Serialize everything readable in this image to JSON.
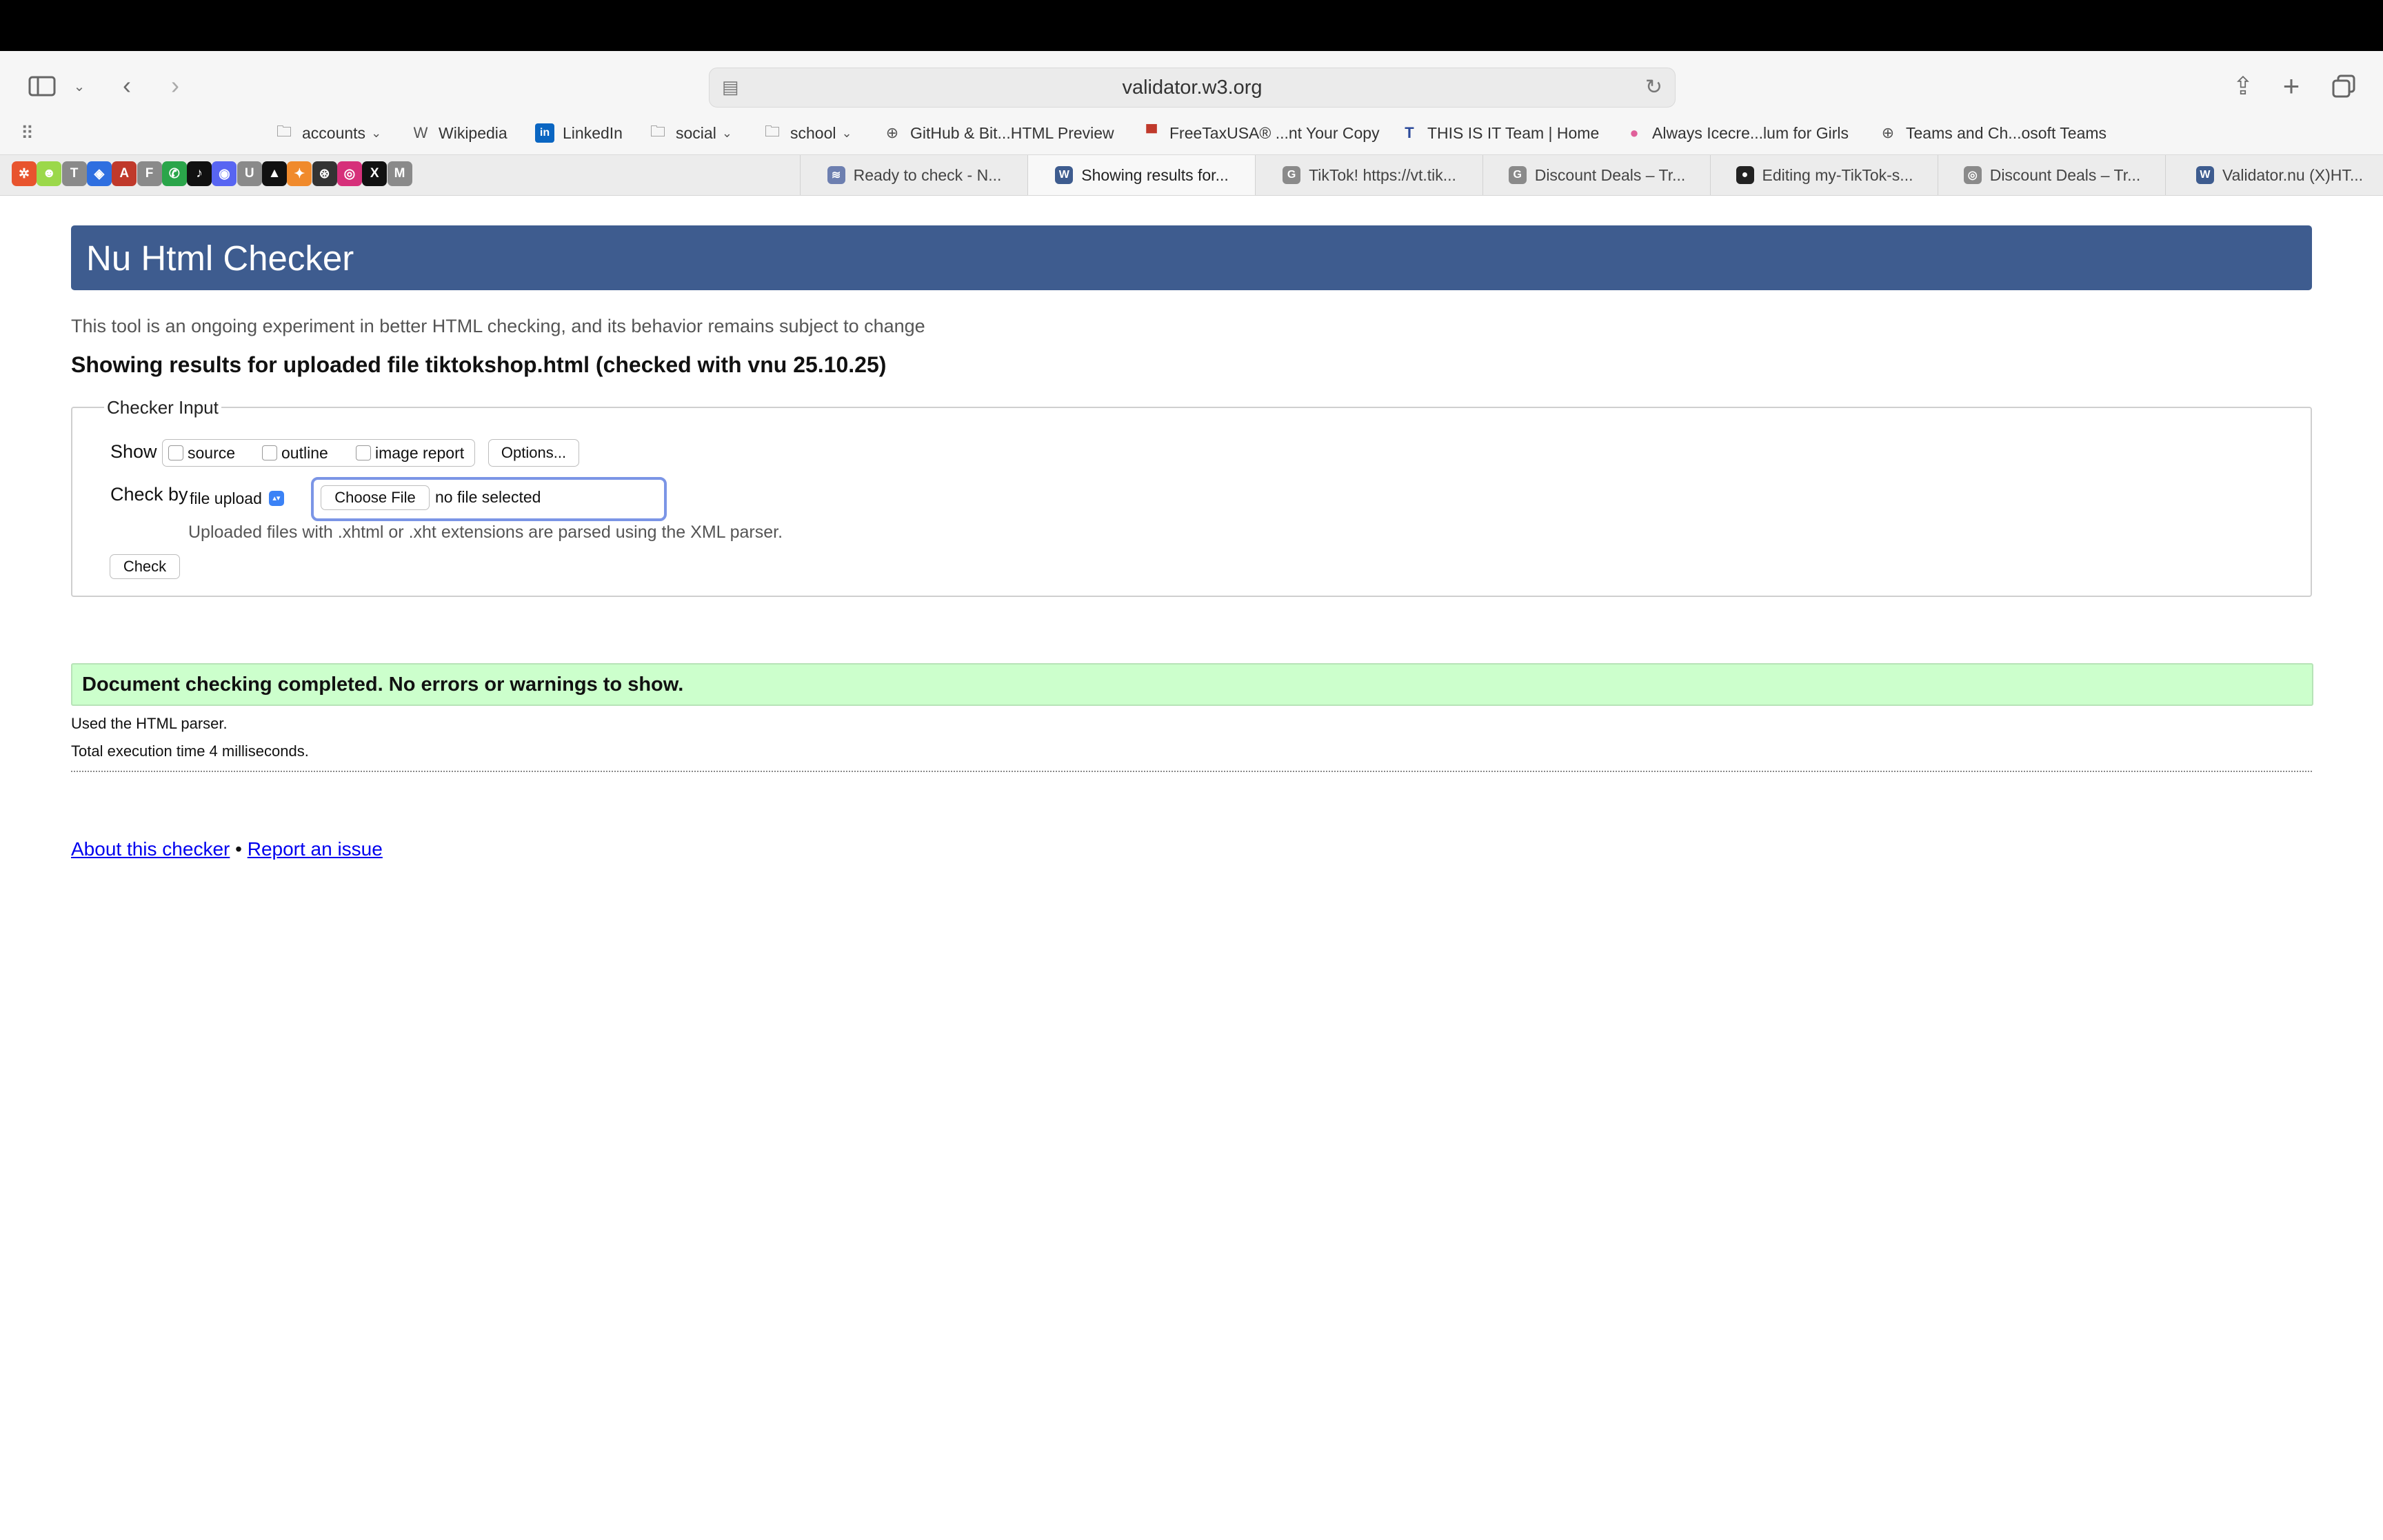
{
  "browser": {
    "url": "validator.w3.org",
    "favorites": [
      {
        "label": "accounts",
        "icon": "folder-icon",
        "chevron": true
      },
      {
        "label": "Wikipedia",
        "icon": "wikipedia-icon",
        "chevron": false
      },
      {
        "label": "LinkedIn",
        "icon": "linkedin-icon",
        "chevron": false
      },
      {
        "label": "social",
        "icon": "folder-icon",
        "chevron": true
      },
      {
        "label": "school",
        "icon": "folder-icon",
        "chevron": true
      },
      {
        "label": "GitHub & Bit...HTML Preview",
        "icon": "globe-icon",
        "chevron": false
      },
      {
        "label": "FreeTaxUSA® ...nt Your Copy",
        "icon": "flag-icon",
        "chevron": false
      },
      {
        "label": "THIS IS IT Team | Home",
        "icon": "team-icon",
        "chevron": false
      },
      {
        "label": "Always Icecre...lum for Girls",
        "icon": "circle-icon",
        "chevron": false
      },
      {
        "label": "Teams and Ch...osoft Teams",
        "icon": "globe-icon",
        "chevron": false
      }
    ],
    "pinned_tabs": [
      {
        "glyph": "✲",
        "color": "#e8542e",
        "icon": "asterisk-app-icon"
      },
      {
        "glyph": "☻",
        "color": "#9bd84a",
        "icon": "smiley-app-icon"
      },
      {
        "glyph": "T",
        "color": "#8a8a8a",
        "icon": "t-letter-icon"
      },
      {
        "glyph": "◈",
        "color": "#2f6fe0",
        "icon": "diamond-app-icon"
      },
      {
        "glyph": "A",
        "color": "#c0392b",
        "icon": "a-letter-icon"
      },
      {
        "glyph": "F",
        "color": "#8a8a8a",
        "icon": "f-letter-icon"
      },
      {
        "glyph": "✆",
        "color": "#2aa54a",
        "icon": "phone-icon"
      },
      {
        "glyph": "♪",
        "color": "#111111",
        "icon": "tiktok-icon"
      },
      {
        "glyph": "◉",
        "color": "#5865f2",
        "icon": "discord-icon"
      },
      {
        "glyph": "U",
        "color": "#8a8a8a",
        "icon": "u-letter-icon"
      },
      {
        "glyph": "▲",
        "color": "#111111",
        "icon": "triangle-app-icon"
      },
      {
        "glyph": "✦",
        "color": "#f08a2c",
        "icon": "bird-app-icon"
      },
      {
        "glyph": "⊛",
        "color": "#333333",
        "icon": "openai-icon"
      },
      {
        "glyph": "◎",
        "color": "#d6307a",
        "icon": "instagram-icon"
      },
      {
        "glyph": "X",
        "color": "#111111",
        "icon": "x-icon"
      },
      {
        "glyph": "M",
        "color": "#8a8a8a",
        "icon": "m-letter-icon"
      }
    ],
    "tabs": [
      {
        "label": "Ready to check - N...",
        "icon": "validator-icon",
        "glyph": "≋",
        "color": "#6d7fb0",
        "active": false
      },
      {
        "label": "Showing results for...",
        "icon": "validator-icon",
        "glyph": "W",
        "color": "#3e5c8f",
        "active": true
      },
      {
        "label": "TikTok! https://vt.tik...",
        "icon": "g-letter-icon",
        "glyph": "G",
        "color": "#8a8a8a",
        "active": false
      },
      {
        "label": "Discount Deals – Tr...",
        "icon": "g-letter-icon",
        "glyph": "G",
        "color": "#8a8a8a",
        "active": false
      },
      {
        "label": "Editing my-TikTok-s...",
        "icon": "github-icon",
        "glyph": "●",
        "color": "#222222",
        "active": false
      },
      {
        "label": "Discount Deals – Tr...",
        "icon": "compass-icon",
        "glyph": "◎",
        "color": "#8a8a8a",
        "active": false
      },
      {
        "label": "Validator.nu (X)HT...",
        "icon": "validator-icon",
        "glyph": "W",
        "color": "#3e5c8f",
        "active": false
      }
    ]
  },
  "page": {
    "banner_title": "Nu Html Checker",
    "banner_color": "#3e5c8f",
    "intro": "This tool is an ongoing experiment in better HTML checking, and its behavior remains subject to change",
    "results_heading": "Showing results for uploaded file tiktokshop.html (checked with vnu 25.10.25)",
    "checker_input": {
      "legend": "Checker Input",
      "show_label": "Show",
      "options": {
        "source": "source",
        "outline": "outline",
        "image_report": "image report"
      },
      "options_button": "Options...",
      "check_by_label": "Check by",
      "check_by_value": "file upload",
      "choose_file": "Choose File",
      "file_status": "no file selected",
      "file_note": "Uploaded files with .xhtml or .xht extensions are parsed using the XML parser.",
      "check_button": "Check"
    },
    "success_message": "Document checking completed. No errors or warnings to show.",
    "success_color": "#ccffcc",
    "parser_info": "Used the HTML parser.",
    "execution_time": "Total execution time 4 milliseconds.",
    "footer": {
      "about": "About this checker",
      "separator": "•",
      "report": "Report an issue"
    }
  }
}
